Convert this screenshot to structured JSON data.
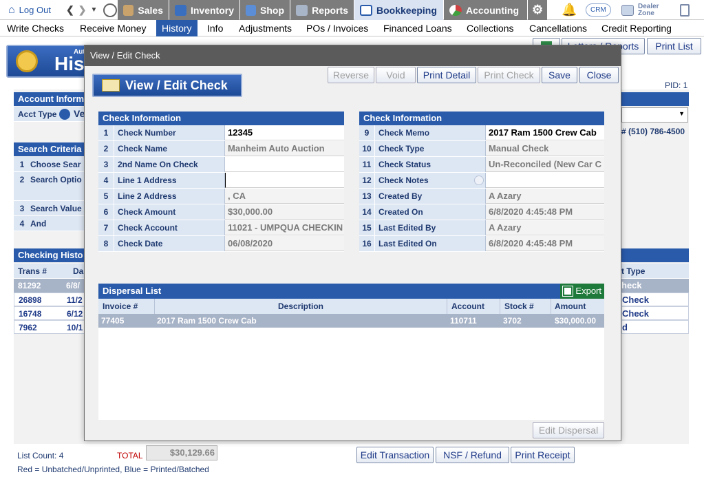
{
  "topbar": {
    "logout": "Log Out",
    "tabs": [
      "Sales",
      "Inventory",
      "Shop",
      "Reports",
      "Bookkeeping",
      "Accounting"
    ],
    "crm": "CRM",
    "dealer_zone": "Dealer Zone"
  },
  "menu": [
    "Write Checks",
    "Receive Money",
    "History",
    "Info",
    "Adjustments",
    "POs / Invoices",
    "Financed Loans",
    "Collections",
    "Cancellations",
    "Credit Reporting"
  ],
  "background": {
    "banner_small": "Aut",
    "banner_big": "His",
    "right_buttons": [
      "Letters / Reports",
      "Print List"
    ],
    "pid": "PID: 1",
    "phone": "# (510) 786-4500",
    "account_header": "Account Inform",
    "acct_type_label": "Acct Type",
    "acct_type_value": "Ve",
    "search_header": "Search Criteria",
    "search_rows": [
      {
        "num": "1",
        "label": "Choose Sear"
      },
      {
        "num": "2",
        "label": "Search Optio"
      },
      {
        "num": "3",
        "label": "Search Value"
      },
      {
        "num": "4",
        "label": "And"
      }
    ],
    "history_header": "Checking Histo",
    "history_cols": [
      "Trans #",
      "Da"
    ],
    "history_right_col": "t Type",
    "history_rows": [
      {
        "trans": "81292",
        "date": "6/8/",
        "type": "heck"
      },
      {
        "trans": "26898",
        "date": "11/2",
        "type": "Check"
      },
      {
        "trans": "16748",
        "date": "6/12",
        "type": "Check"
      },
      {
        "trans": "7962",
        "date": "10/1",
        "type": "d"
      }
    ],
    "list_count": "List Count: 4",
    "total_label": "TOTAL",
    "total_value": "$30,129.66",
    "legend": "Red = Unbatched/Unprinted, Blue = Printed/Batched",
    "bottom_buttons": [
      "Edit Transaction",
      "NSF / Refund",
      "Print Receipt"
    ]
  },
  "modal": {
    "title": "View / Edit Check",
    "heading": "View / Edit Check",
    "buttons": {
      "reverse": "Reverse",
      "void": "Void",
      "print_detail": "Print Detail",
      "print_check": "Print Check",
      "save": "Save",
      "close": "Close"
    },
    "left_header": "Check Information",
    "right_header": "Check Information",
    "left_rows": [
      {
        "num": "1",
        "label": "Check Number",
        "value": "12345"
      },
      {
        "num": "2",
        "label": "Check Name",
        "value": "Manheim Auto Auction"
      },
      {
        "num": "3",
        "label": "2nd Name On Check",
        "value": ""
      },
      {
        "num": "4",
        "label": "Line 1 Address",
        "value": ""
      },
      {
        "num": "5",
        "label": "Line 2 Address",
        "value": ", CA"
      },
      {
        "num": "6",
        "label": "Check Amount",
        "value": "$30,000.00"
      },
      {
        "num": "7",
        "label": "Check Account",
        "value": "11021 - UMPQUA CHECKIN"
      },
      {
        "num": "8",
        "label": "Check Date",
        "value": "06/08/2020"
      }
    ],
    "right_rows": [
      {
        "num": "9",
        "label": "Check Memo",
        "value": "2017 Ram 1500 Crew Cab"
      },
      {
        "num": "10",
        "label": "Check Type",
        "value": "Manual Check"
      },
      {
        "num": "11",
        "label": "Check Status",
        "value": "Un-Reconciled (New Car C"
      },
      {
        "num": "12",
        "label": "Check Notes",
        "value": ""
      },
      {
        "num": "13",
        "label": "Created By",
        "value": "A Azary"
      },
      {
        "num": "14",
        "label": "Created On",
        "value": "6/8/2020 4:45:48 PM"
      },
      {
        "num": "15",
        "label": "Last Edited By",
        "value": "A Azary"
      },
      {
        "num": "16",
        "label": "Last Edited On",
        "value": "6/8/2020 4:45:48 PM"
      }
    ],
    "dispersal": {
      "header": "Dispersal List",
      "export": "Export",
      "columns": [
        "Invoice #",
        "Description",
        "Account",
        "Stock #",
        "Amount"
      ],
      "rows": [
        {
          "invoice": "77405",
          "description": "2017 Ram 1500 Crew Cab",
          "account": "110711",
          "stock": "3702",
          "amount": "$30,000.00"
        }
      ],
      "edit_button": "Edit Dispersal"
    }
  }
}
